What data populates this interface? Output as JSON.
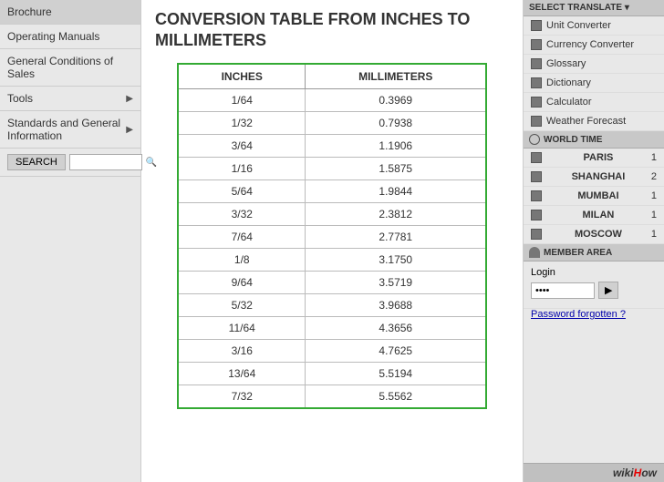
{
  "sidebar": {
    "items": [
      {
        "label": "Brochure",
        "has_arrow": false
      },
      {
        "label": "Operating Manuals",
        "has_arrow": false
      },
      {
        "label": "General Conditions of Sales",
        "has_arrow": false
      },
      {
        "label": "Tools",
        "has_arrow": true
      },
      {
        "label": "Standards and General Information",
        "has_arrow": true
      }
    ],
    "search_label": "SEARCH",
    "search_placeholder": ""
  },
  "main": {
    "title_line1": "CONVERSION   TABLE   FROM   INCHES   TO",
    "title_line2": "MILLIMETERS",
    "table": {
      "col1_header": "INCHES",
      "col2_header": "MILLIMETERS",
      "rows": [
        {
          "inches": "1/64",
          "mm": "0.3969"
        },
        {
          "inches": "1/32",
          "mm": "0.7938"
        },
        {
          "inches": "3/64",
          "mm": "1.1906"
        },
        {
          "inches": "1/16",
          "mm": "1.5875"
        },
        {
          "inches": "5/64",
          "mm": "1.9844"
        },
        {
          "inches": "3/32",
          "mm": "2.3812"
        },
        {
          "inches": "7/64",
          "mm": "2.7781"
        },
        {
          "inches": "1/8",
          "mm": "3.1750"
        },
        {
          "inches": "9/64",
          "mm": "3.5719"
        },
        {
          "inches": "5/32",
          "mm": "3.9688"
        },
        {
          "inches": "11/64",
          "mm": "4.3656"
        },
        {
          "inches": "3/16",
          "mm": "4.7625"
        },
        {
          "inches": "13/64",
          "mm": "5.5194"
        },
        {
          "inches": "7/32",
          "mm": "5.5562"
        }
      ]
    }
  },
  "right_sidebar": {
    "section_label": "SELECT TRANSLATE ▾",
    "tools_items": [
      {
        "label": "Unit Converter"
      },
      {
        "label": "Currency Converter"
      },
      {
        "label": "Glossary"
      },
      {
        "label": "Dictionary"
      },
      {
        "label": "Calculator"
      },
      {
        "label": "Weather Forecast"
      }
    ],
    "world_time_label": "WORLD TIME",
    "cities": [
      {
        "name": "PARIS",
        "time": "1"
      },
      {
        "name": "SHANGHAI",
        "time": "2"
      },
      {
        "name": "MUMBAI",
        "time": "1"
      },
      {
        "name": "MILAN",
        "time": "1"
      },
      {
        "name": "MOSCOW",
        "time": "1"
      }
    ],
    "member_area_label": "MEMBER AREA",
    "login_label": "Login",
    "login_placeholder": "",
    "password_placeholder": "••••",
    "forgot_password": "Password forgotten ?",
    "login_btn_label": "▶",
    "wikihow": "wiki How"
  }
}
